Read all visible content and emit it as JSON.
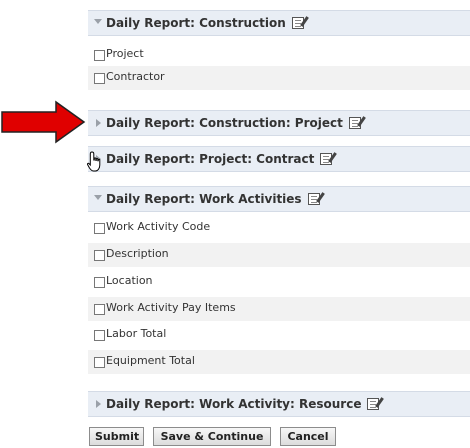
{
  "sections": [
    {
      "title": "Daily Report: Construction",
      "expanded": true,
      "items": [
        "Project",
        "Contractor"
      ]
    },
    {
      "title": "Daily Report: Construction: Project",
      "expanded": false
    },
    {
      "title": "Daily Report: Project: Contract",
      "expanded": false
    },
    {
      "title": "Daily Report: Work Activities",
      "expanded": true,
      "items": [
        "Work Activity Code",
        "Description",
        "Location",
        "Work Activity Pay Items",
        "Labor Total",
        "Equipment Total"
      ]
    },
    {
      "title": "Daily Report: Work Activity: Resource",
      "expanded": false
    }
  ],
  "buttons": {
    "submit": "Submit",
    "save_continue": "Save & Continue",
    "cancel": "Cancel"
  },
  "icons": {
    "annotation_arrow": "red-arrow-icon",
    "cursor": "hand-pointer-icon",
    "edit": "edit-note-icon"
  },
  "colors": {
    "header_bg": "#e9eef5",
    "arrow": "#e00000"
  }
}
